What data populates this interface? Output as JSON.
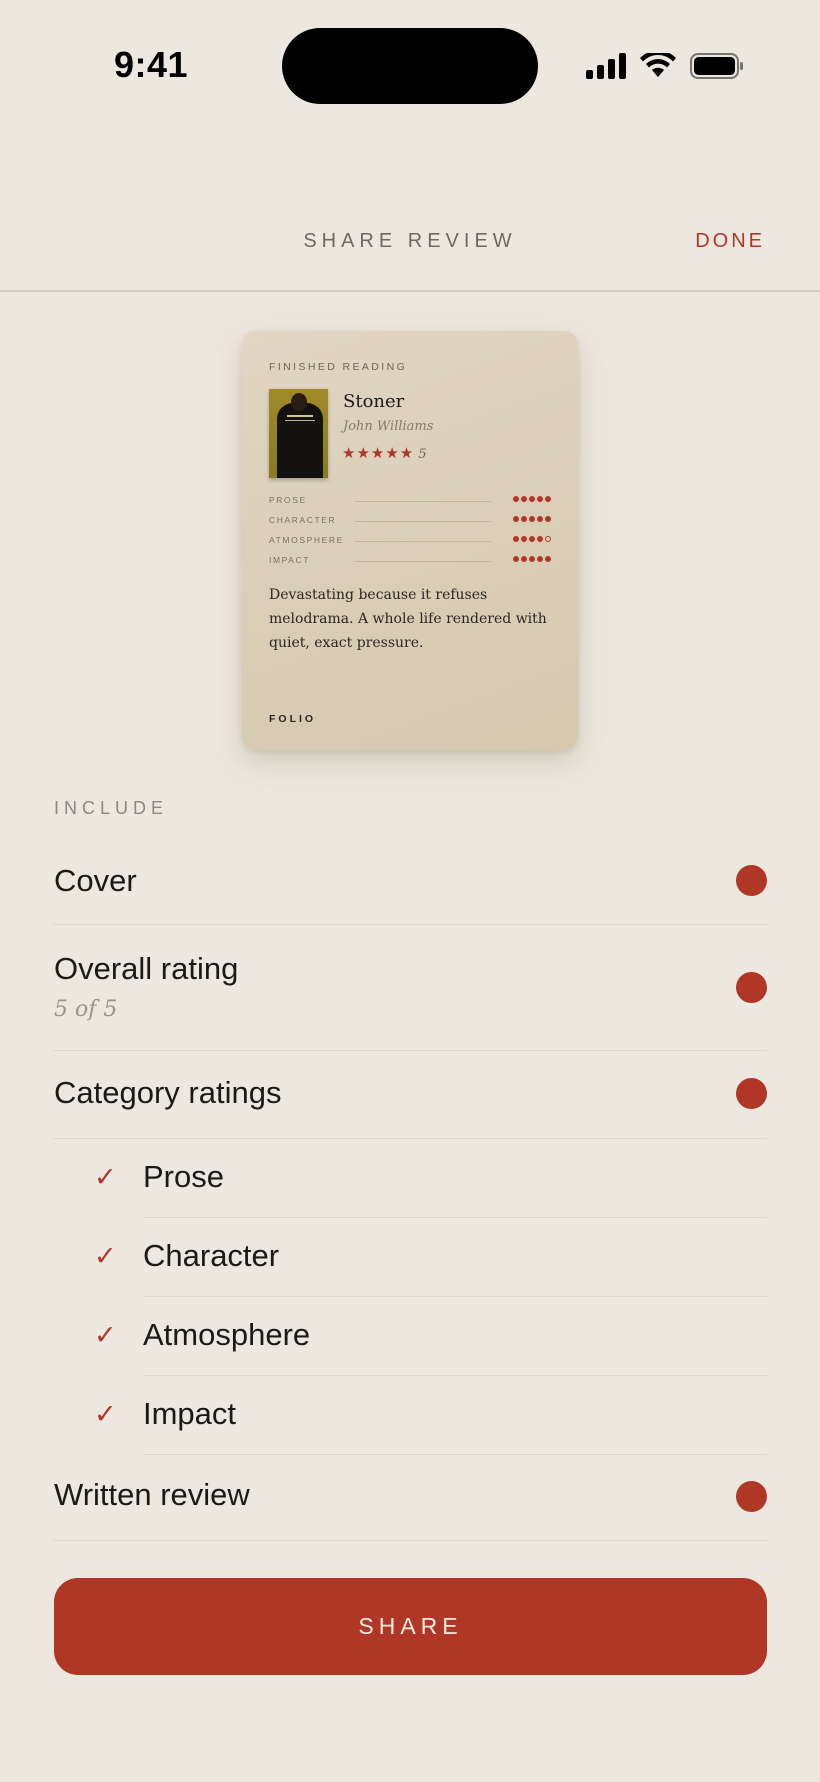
{
  "status_bar": {
    "time": "9:41"
  },
  "header": {
    "title": "SHARE REVIEW",
    "done_label": "DONE"
  },
  "card": {
    "kicker": "FINISHED READING",
    "book_title": "Stoner",
    "author": "John Williams",
    "stars": "★★★★★",
    "rating": "5",
    "metrics": [
      {
        "label": "PROSE",
        "value": 5,
        "max": 5
      },
      {
        "label": "CHARACTER",
        "value": 5,
        "max": 5
      },
      {
        "label": "ATMOSPHERE",
        "value": 4,
        "max": 5
      },
      {
        "label": "IMPACT",
        "value": 5,
        "max": 5
      }
    ],
    "quote": "Devastating because it refuses melodrama. A whole life rendered with quiet, exact pressure.",
    "brand": "FOLIO"
  },
  "include": {
    "label": "INCLUDE",
    "cover": {
      "label": "Cover",
      "enabled": true
    },
    "overall_rating": {
      "label": "Overall rating",
      "sub": "5 of 5",
      "enabled": true
    },
    "category_ratings": {
      "label": "Category ratings",
      "enabled": true
    },
    "categories": [
      {
        "label": "Prose",
        "checked": true
      },
      {
        "label": "Character",
        "checked": true
      },
      {
        "label": "Atmosphere",
        "checked": true
      },
      {
        "label": "Impact",
        "checked": true
      }
    ],
    "written_review": {
      "label": "Written review",
      "enabled": true
    }
  },
  "share_label": "SHARE",
  "colors": {
    "accent": "#b03626",
    "background": "#ede8df",
    "card": "#ddd2bd"
  },
  "icons": {
    "signal": "cellular-signal-icon",
    "wifi": "wifi-icon",
    "battery": "battery-icon",
    "check": "checkmark-icon"
  }
}
